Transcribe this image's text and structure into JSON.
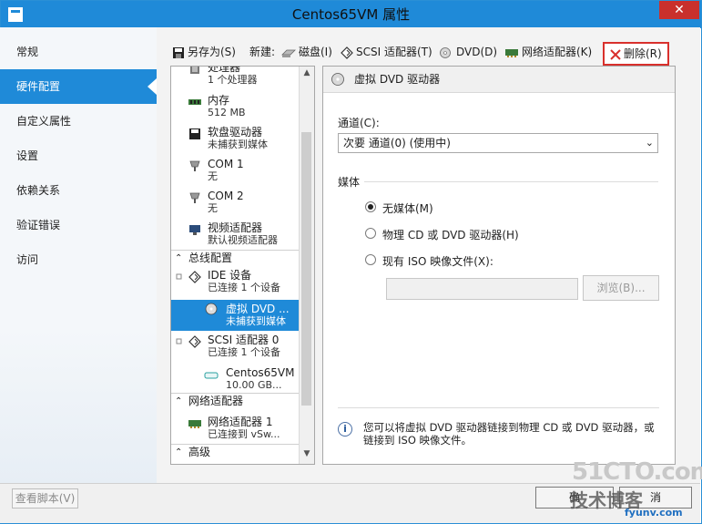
{
  "window": {
    "title": "Centos65VM 属性",
    "close_label": "✕"
  },
  "nav": {
    "items": [
      {
        "label": "常规"
      },
      {
        "label": "硬件配置"
      },
      {
        "label": "自定义属性"
      },
      {
        "label": "设置"
      },
      {
        "label": "依赖关系"
      },
      {
        "label": "验证错误"
      },
      {
        "label": "访问"
      }
    ],
    "selected": "硬件配置"
  },
  "toolbar": {
    "save_as": "另存为(S)",
    "new_label": "新建:",
    "disk": "磁盘(I)",
    "scsi": "SCSI 适配器(T)",
    "dvd": "DVD(D)",
    "nic": "网络适配器(K)",
    "delete": "删除(R)"
  },
  "tree": {
    "items": [
      {
        "title": "处理器",
        "subtitle": "1 个处理器"
      },
      {
        "title": "内存",
        "subtitle": "512 MB"
      },
      {
        "title": "软盘驱动器",
        "subtitle": "未捕获到媒体"
      },
      {
        "title": "COM 1",
        "subtitle": "无"
      },
      {
        "title": "COM 2",
        "subtitle": "无"
      },
      {
        "title": "视频适配器",
        "subtitle": "默认视频适配器"
      }
    ],
    "categories": {
      "bus": "总线配置",
      "network": "网络适配器",
      "advanced": "高级"
    },
    "bus_items": [
      {
        "title": "IDE 设备",
        "subtitle": "已连接 1 个设备"
      },
      {
        "title": "虚拟 DVD ...",
        "subtitle": "未捕获到媒体"
      },
      {
        "title": "SCSI 适配器 0",
        "subtitle": "已连接 1 个设备"
      },
      {
        "title": "Centos65VM",
        "subtitle": "10.00 GB..."
      }
    ],
    "network_items": [
      {
        "title": "网络适配器 1",
        "subtitle": "已连接到 vSw..."
      }
    ]
  },
  "panel": {
    "title": "虚拟 DVD 驱动器",
    "channel_label": "通道(C):",
    "channel_value": "次要 通道(0) (使用中)",
    "media_label": "媒体",
    "radio_none": "无媒体(M)",
    "radio_physical": "物理 CD 或 DVD 驱动器(H)",
    "radio_iso": "现有 ISO 映像文件(X):",
    "selected_media": "none",
    "browse": "浏览(B)...",
    "info": "您可以将虚拟 DVD 驱动器链接到物理 CD 或 DVD 驱动器，或链接到 ISO 映像文件。"
  },
  "footer": {
    "view_script": "查看脚本(V)",
    "ok": "确",
    "cancel": "消"
  },
  "watermark": {
    "line1": "51CTO.com",
    "line2": "技术博客",
    "line3": "fyunv.com"
  }
}
